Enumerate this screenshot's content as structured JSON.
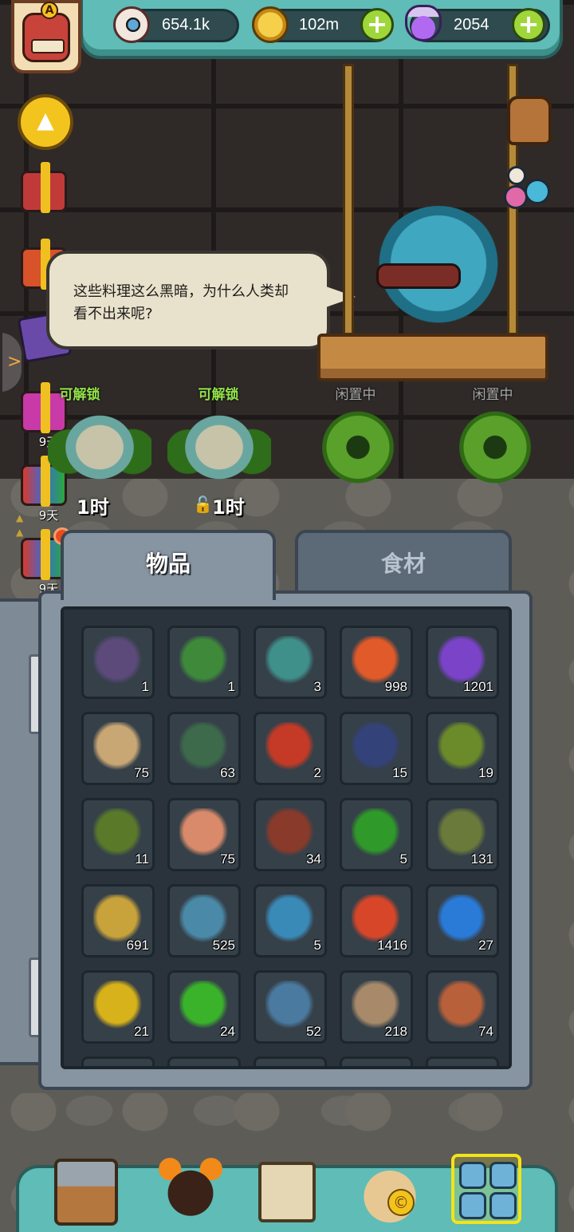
{
  "resources": {
    "eyeballs": "654.1k",
    "coins": "102m",
    "potions": "2054"
  },
  "player": {
    "rank_badge": "A"
  },
  "speech_bubble": {
    "line1": "这些料理这么黑暗，为什么人类却",
    "line2": "看不出来呢?"
  },
  "side_gifts": [
    {
      "days": "9天"
    },
    {
      "days": "9天"
    },
    {
      "days": "9天"
    },
    {
      "days": "9天"
    }
  ],
  "slots": [
    {
      "status": "可解锁",
      "time": "1时"
    },
    {
      "status": "可解锁",
      "time": "1时"
    },
    {
      "status": "闲置中"
    },
    {
      "status": "闲置中"
    }
  ],
  "tabs": {
    "items": "物品",
    "ingredients": "食材"
  },
  "inventory": [
    {
      "icon": "chest-eye-icon",
      "count": "1",
      "color": "#5b4a7a"
    },
    {
      "icon": "green-bottle-icon",
      "count": "1",
      "color": "#3f8a3a"
    },
    {
      "icon": "teal-bottle-icon",
      "count": "3",
      "color": "#3f8f8a"
    },
    {
      "icon": "pill-capsule-icon",
      "count": "998",
      "color": "#e05a2a"
    },
    {
      "icon": "purple-powder-icon",
      "count": "1201",
      "color": "#7a43c8"
    },
    {
      "icon": "parchment-map-icon",
      "count": "75",
      "color": "#c9a774"
    },
    {
      "icon": "picture-card-icon",
      "count": "63",
      "color": "#3d6a4a"
    },
    {
      "icon": "red-barrel-icon",
      "count": "2",
      "color": "#c43a26"
    },
    {
      "icon": "dark-card-icon",
      "count": "15",
      "color": "#34427a"
    },
    {
      "icon": "monster-card-icon",
      "count": "19",
      "color": "#6b8a2a"
    },
    {
      "icon": "green-ore-icon",
      "count": "11",
      "color": "#5a7a2a"
    },
    {
      "icon": "pink-scroll-icon",
      "count": "75",
      "color": "#d88a6a"
    },
    {
      "icon": "stained-glass-icon",
      "count": "34",
      "color": "#8a3a2a"
    },
    {
      "icon": "four-leaf-clover-icon",
      "count": "5",
      "color": "#2f9a2a"
    },
    {
      "icon": "spiky-shell-icon",
      "count": "131",
      "color": "#6a7a3a"
    },
    {
      "icon": "gold-chest-icon",
      "count": "691",
      "color": "#c8a23a"
    },
    {
      "icon": "blob-ring-icon",
      "count": "525",
      "color": "#4a8aa8"
    },
    {
      "icon": "blue-puzzle-icon",
      "count": "5",
      "color": "#3a8ab8"
    },
    {
      "icon": "red-triangle-gem-icon",
      "count": "1416",
      "color": "#d8462a"
    },
    {
      "icon": "blue-square-gem-icon",
      "count": "27",
      "color": "#2a7ad8"
    },
    {
      "icon": "yellow-pentagon-gem-icon",
      "count": "21",
      "color": "#d8b21a"
    },
    {
      "icon": "green-hexagon-gem-icon",
      "count": "24",
      "color": "#3ab22a"
    },
    {
      "icon": "gear-jar-icon",
      "count": "52",
      "color": "#4a7aa0"
    },
    {
      "icon": "rope-noodle-icon",
      "count": "218",
      "color": "#a88a6a"
    },
    {
      "icon": "drumstick-icon",
      "count": "74",
      "color": "#b8603a"
    }
  ]
}
